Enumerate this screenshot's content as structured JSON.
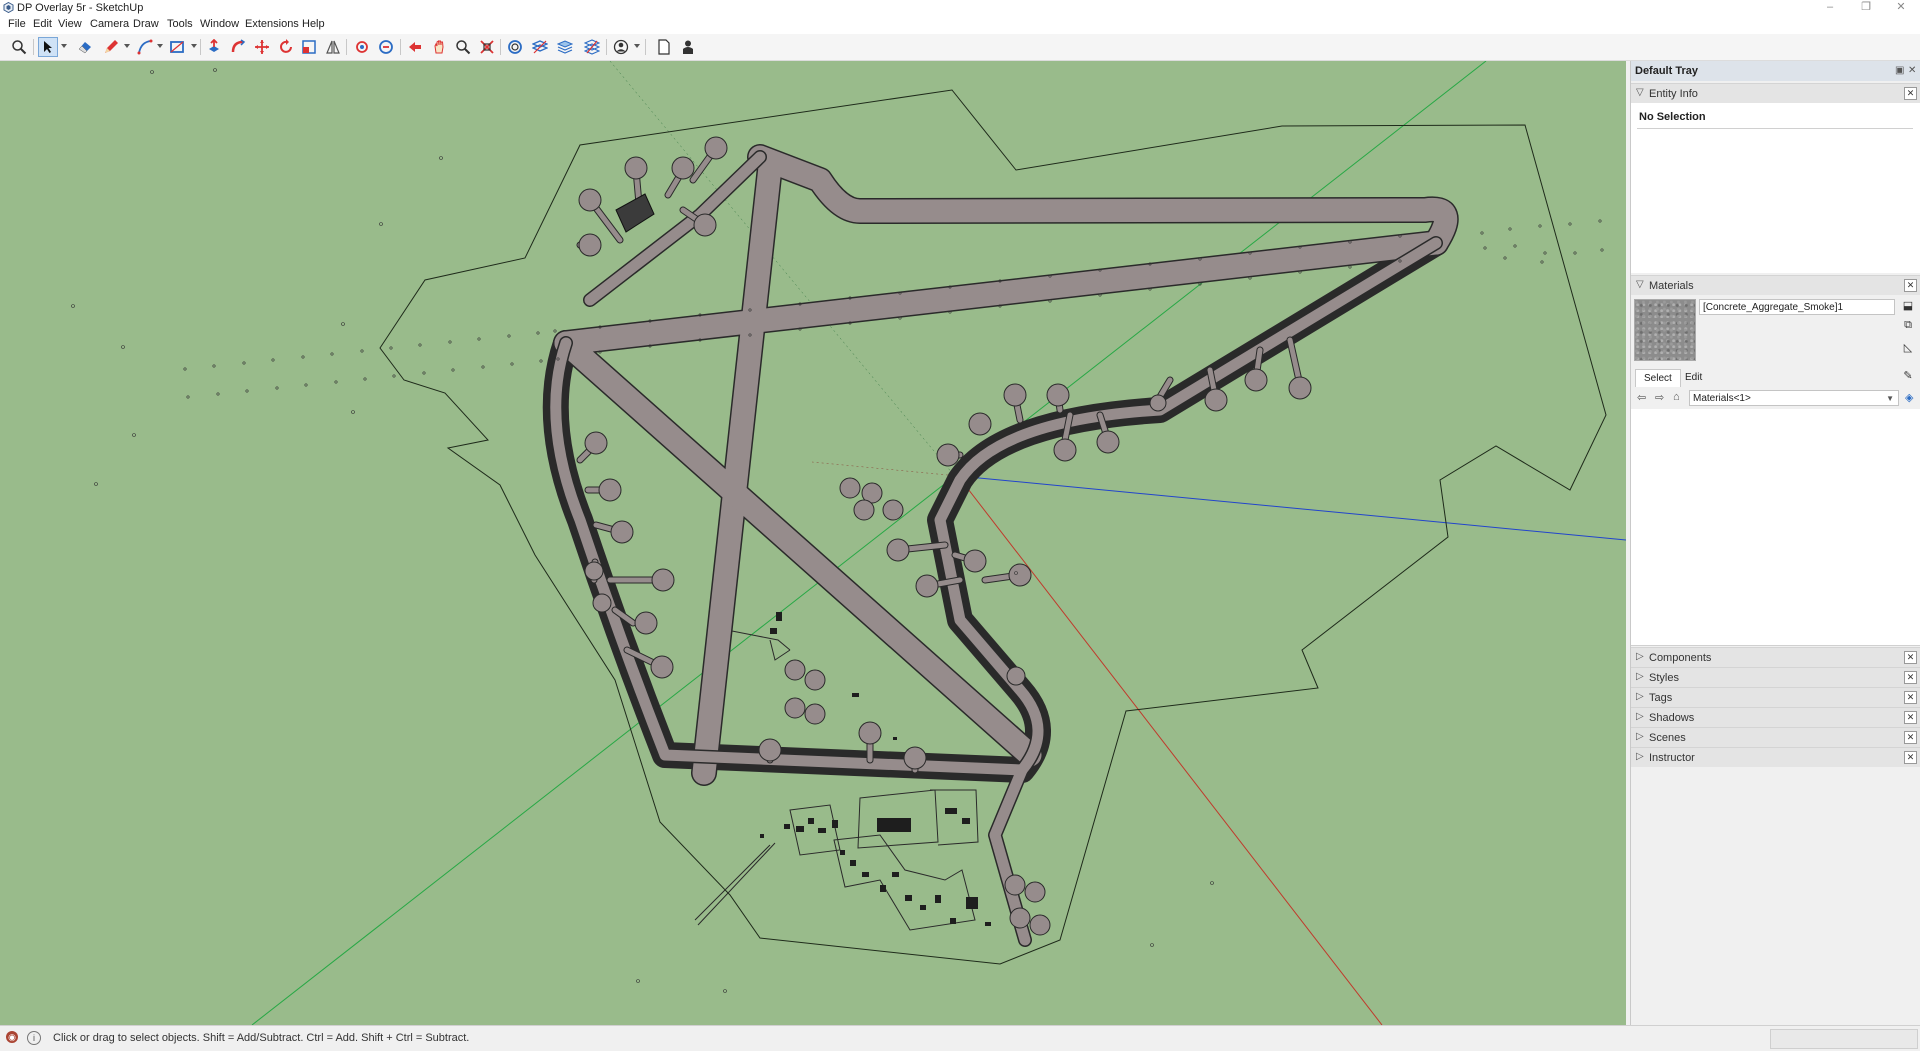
{
  "window": {
    "title": "DP Overlay 5r - SketchUp",
    "controls": [
      "–",
      "❐",
      "✕"
    ]
  },
  "menu": [
    "File",
    "Edit",
    "View",
    "Camera",
    "Draw",
    "Tools",
    "Window",
    "Extensions",
    "Help"
  ],
  "toolbar": {
    "tools": [
      "search-icon",
      "select-icon",
      "eraser-icon",
      "pencil-icon",
      "arc-icon",
      "rectangle-icon",
      "push-pull-icon",
      "follow-me-icon",
      "move-icon",
      "rotate-icon",
      "scale-icon",
      "offset-icon",
      "orbit-icon",
      "pan-icon",
      "previous-view-icon",
      "walk-icon",
      "zoom-icon",
      "zoom-extents-icon",
      "get-models-icon",
      "sandbox-icon",
      "layers-icon",
      "stack-icon",
      "profile-icon",
      "new-page-icon",
      "person-icon"
    ],
    "active_tool": "select-icon"
  },
  "tray": {
    "title": "Default Tray",
    "entity_info": {
      "label": "Entity Info",
      "selection": "No Selection"
    },
    "materials": {
      "label": "Materials",
      "current_material": "[Concrete_Aggregate_Smoke]1",
      "tabs": [
        "Select",
        "Edit"
      ],
      "active_tab": "Select",
      "library": "Materials<1>"
    },
    "collapsed_panels": [
      "Components",
      "Styles",
      "Tags",
      "Shadows",
      "Scenes",
      "Instructor"
    ]
  },
  "status": {
    "message": "Click or drag to select objects. Shift = Add/Subtract. Ctrl = Add. Shift + Ctrl = Subtract."
  },
  "colors": {
    "viewport_bg": "#99bb8b",
    "pavement": "#968c8c",
    "axis_red": "#c0392b",
    "axis_green": "#27a845",
    "axis_blue": "#2244cc"
  }
}
